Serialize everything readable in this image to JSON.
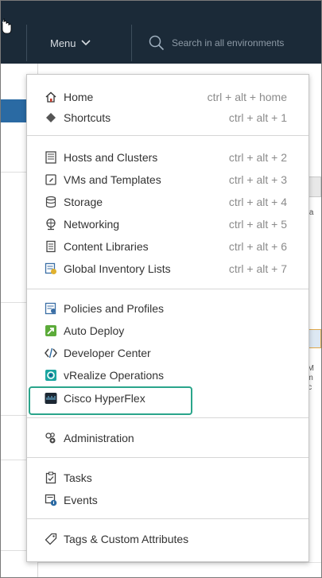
{
  "header": {
    "menu_label": "Menu",
    "search_placeholder": "Search in all environments"
  },
  "menu": {
    "group1": [
      {
        "label": "Home",
        "shortcut": "ctrl + alt + home",
        "icon": "home-icon"
      },
      {
        "label": "Shortcuts",
        "shortcut": "ctrl + alt + 1",
        "icon": "shortcuts-icon"
      }
    ],
    "group2": [
      {
        "label": "Hosts and Clusters",
        "shortcut": "ctrl + alt + 2",
        "icon": "hosts-clusters-icon"
      },
      {
        "label": "VMs and Templates",
        "shortcut": "ctrl + alt + 3",
        "icon": "vm-templates-icon"
      },
      {
        "label": "Storage",
        "shortcut": "ctrl + alt + 4",
        "icon": "storage-icon"
      },
      {
        "label": "Networking",
        "shortcut": "ctrl + alt + 5",
        "icon": "networking-icon"
      },
      {
        "label": "Content Libraries",
        "shortcut": "ctrl + alt + 6",
        "icon": "content-libraries-icon"
      },
      {
        "label": "Global Inventory Lists",
        "shortcut": "ctrl + alt + 7",
        "icon": "global-inventory-icon"
      }
    ],
    "group3": [
      {
        "label": "Policies and Profiles",
        "icon": "policies-icon"
      },
      {
        "label": "Auto Deploy",
        "icon": "auto-deploy-icon"
      },
      {
        "label": "Developer Center",
        "icon": "developer-center-icon"
      },
      {
        "label": "vRealize Operations",
        "icon": "vrealize-icon"
      },
      {
        "label": "Cisco HyperFlex",
        "icon": "cisco-icon"
      }
    ],
    "group4": [
      {
        "label": "Administration",
        "icon": "administration-icon"
      }
    ],
    "group5": [
      {
        "label": "Tasks",
        "icon": "tasks-icon"
      },
      {
        "label": "Events",
        "icon": "events-icon"
      }
    ],
    "group6": [
      {
        "label": "Tags & Custom Attributes",
        "icon": "tags-icon"
      }
    ]
  },
  "background": {
    "right_text_1": "ora",
    "right_text_2": "VM",
    "right_text_3": "om",
    "right_text_4": "ific"
  },
  "colors": {
    "topbar": "#1b2a38",
    "highlight_border": "#2aa58b",
    "left_accent": "#2a6aa3"
  }
}
